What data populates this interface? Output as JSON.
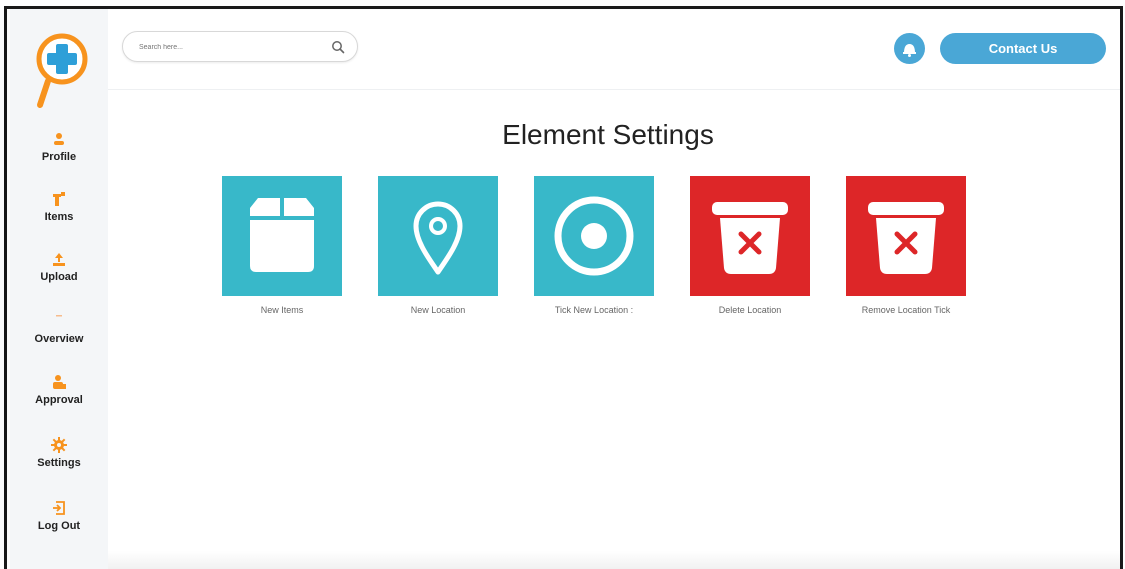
{
  "colors": {
    "accent_blue": "#4aa7d6",
    "tile_teal": "#38b8c9",
    "tile_red": "#dd2628",
    "logo_orange": "#f7931e",
    "logo_blue": "#2e9fd8"
  },
  "sidebar": {
    "logo_icon": "magnifier-plus-logo",
    "items": [
      {
        "label": "Profile",
        "icon": "user-icon"
      },
      {
        "label": "Items",
        "icon": "items-icon"
      },
      {
        "label": "Upload",
        "icon": "upload-icon"
      },
      {
        "label": "Overview",
        "icon": "overview-icon"
      },
      {
        "label": "Approval",
        "icon": "approval-icon"
      },
      {
        "label": "Settings",
        "icon": "gear-icon"
      },
      {
        "label": "Log Out",
        "icon": "logout-icon"
      }
    ]
  },
  "header": {
    "search_placeholder": "Search here...",
    "notification_icon": "bell-icon",
    "contact_label": "Contact Us"
  },
  "main": {
    "title": "Element Settings",
    "tiles": [
      {
        "label": "New  Items",
        "icon": "box-icon",
        "color": "#38b8c9"
      },
      {
        "label": "New Location",
        "icon": "location-pin-icon",
        "color": "#38b8c9"
      },
      {
        "label": "Tick New Location :",
        "icon": "target-icon",
        "color": "#38b8c9"
      },
      {
        "label": "Delete Location",
        "icon": "trash-x-icon",
        "color": "#dd2628"
      },
      {
        "label": "Remove Location Tick",
        "icon": "trash-x-icon",
        "color": "#dd2628"
      }
    ]
  }
}
